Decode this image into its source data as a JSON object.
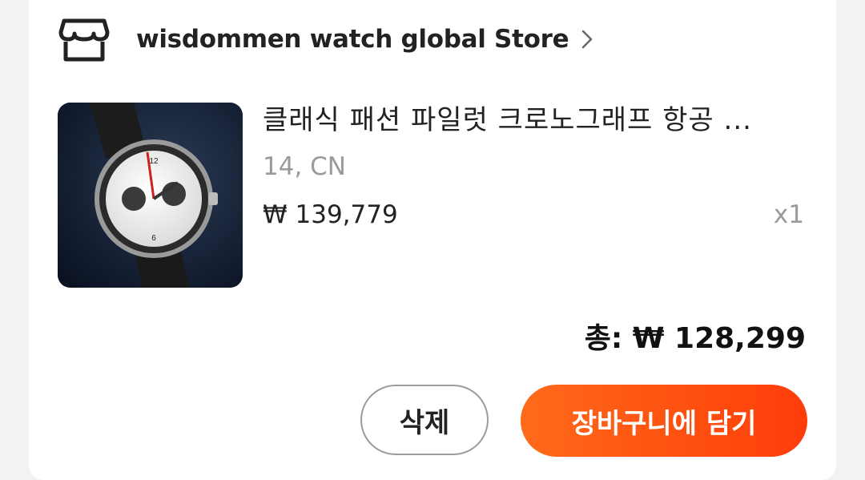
{
  "store": {
    "name": "wisdommen watch global Store",
    "icon": "store-icon",
    "chevron_icon": "chevron-right-icon"
  },
  "item": {
    "title": "클래식 패션 파일럿 크로노그래프 항공 ...",
    "variant": "14, CN",
    "price": "₩ 139,779",
    "quantity": "x1",
    "image": "watch-product-thumbnail"
  },
  "summary": {
    "total": "총: ₩ 128,299"
  },
  "actions": {
    "delete_label": "삭제",
    "add_to_cart_label": "장바구니에 담기"
  },
  "colors": {
    "accent": "#fe4f10",
    "text_primary": "#222222",
    "text_secondary": "#9a9a9a"
  }
}
